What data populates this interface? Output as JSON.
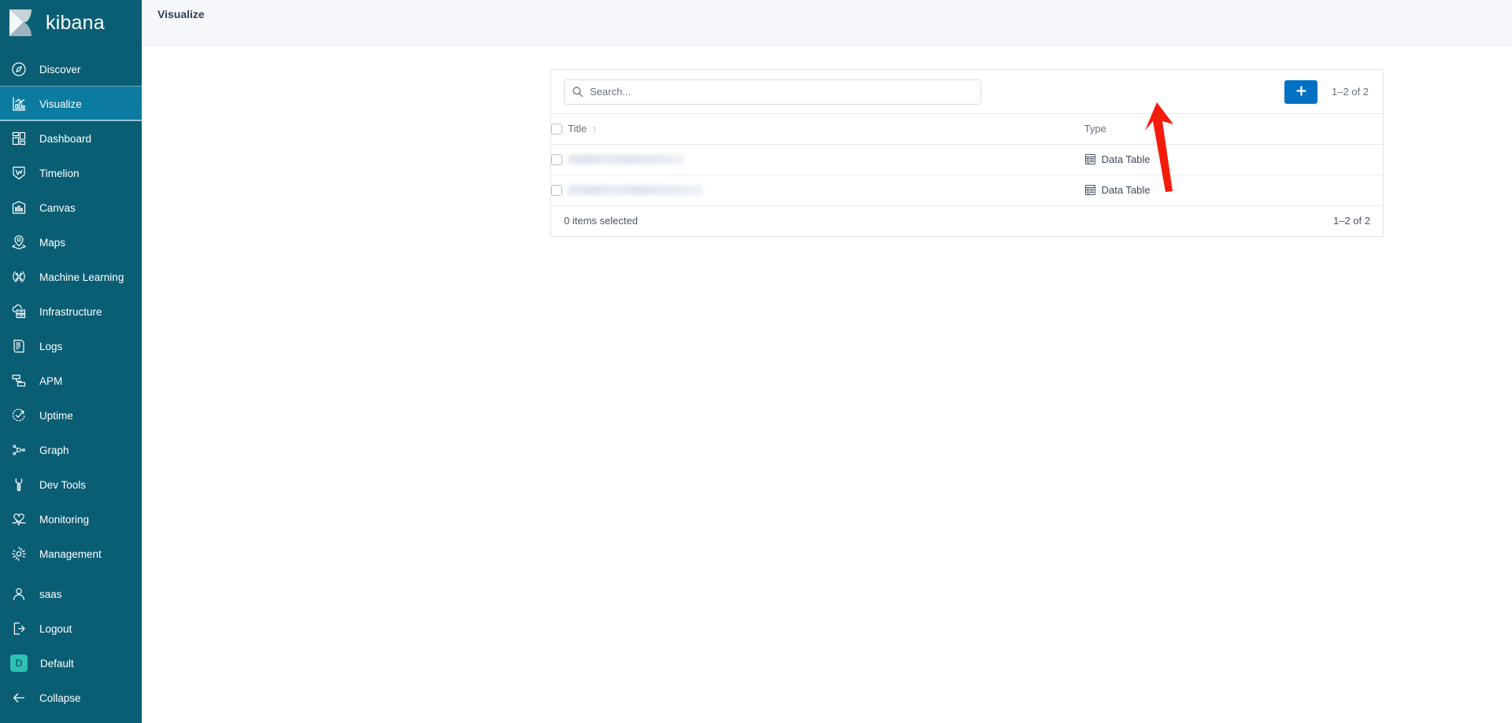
{
  "brand": {
    "name": "kibana",
    "logo_icon": "kibana-logo"
  },
  "sidebar": {
    "items": [
      {
        "label": "Discover",
        "icon": "compass-icon",
        "active": false
      },
      {
        "label": "Visualize",
        "icon": "visualize-icon",
        "active": true
      },
      {
        "label": "Dashboard",
        "icon": "dashboard-icon",
        "active": false
      },
      {
        "label": "Timelion",
        "icon": "timelion-icon",
        "active": false
      },
      {
        "label": "Canvas",
        "icon": "canvas-icon",
        "active": false
      },
      {
        "label": "Maps",
        "icon": "maps-icon",
        "active": false
      },
      {
        "label": "Machine Learning",
        "icon": "machine-learning-icon",
        "active": false
      },
      {
        "label": "Infrastructure",
        "icon": "infrastructure-icon",
        "active": false
      },
      {
        "label": "Logs",
        "icon": "logs-icon",
        "active": false
      },
      {
        "label": "APM",
        "icon": "apm-icon",
        "active": false
      },
      {
        "label": "Uptime",
        "icon": "uptime-icon",
        "active": false
      },
      {
        "label": "Graph",
        "icon": "graph-icon",
        "active": false
      },
      {
        "label": "Dev Tools",
        "icon": "wrench-icon",
        "active": false
      },
      {
        "label": "Monitoring",
        "icon": "monitoring-icon",
        "active": false
      },
      {
        "label": "Management",
        "icon": "gear-icon",
        "active": false
      }
    ],
    "bottom_items": [
      {
        "label": "saas",
        "icon": "user-icon"
      },
      {
        "label": "Logout",
        "icon": "logout-icon"
      },
      {
        "label": "Default",
        "icon": "space-badge",
        "badge_letter": "D"
      },
      {
        "label": "Collapse",
        "icon": "arrow-left-icon"
      }
    ],
    "colors": {
      "background": "#0a5e74",
      "active_background": "#0c7ba0",
      "space_badge": "#2ec0b3",
      "text": "#ffffff"
    }
  },
  "header": {
    "title": "Visualize"
  },
  "toolbar": {
    "search_placeholder": "Search...",
    "search_value": "",
    "search_icon": "search-icon",
    "add_button_label": "+",
    "add_button_icon": "plus-icon",
    "add_button_color": "#0071c2",
    "result_count": "1–2 of 2"
  },
  "table": {
    "columns": [
      {
        "label": "Title",
        "sort_indicator": "↑"
      },
      {
        "label": "Type"
      }
    ],
    "rows": [
      {
        "title": "",
        "title_redacted": true,
        "type": "Data Table",
        "type_icon": "data-table-icon",
        "checked": false
      },
      {
        "title": "",
        "title_redacted": true,
        "type": "Data Table",
        "type_icon": "data-table-icon",
        "checked": false
      }
    ]
  },
  "footer": {
    "selected_text": "0 items selected",
    "result_count": "1–2 of 2"
  },
  "annotation": {
    "type": "arrow",
    "color": "#f51b0b",
    "points_to": "add-visualization-button"
  }
}
